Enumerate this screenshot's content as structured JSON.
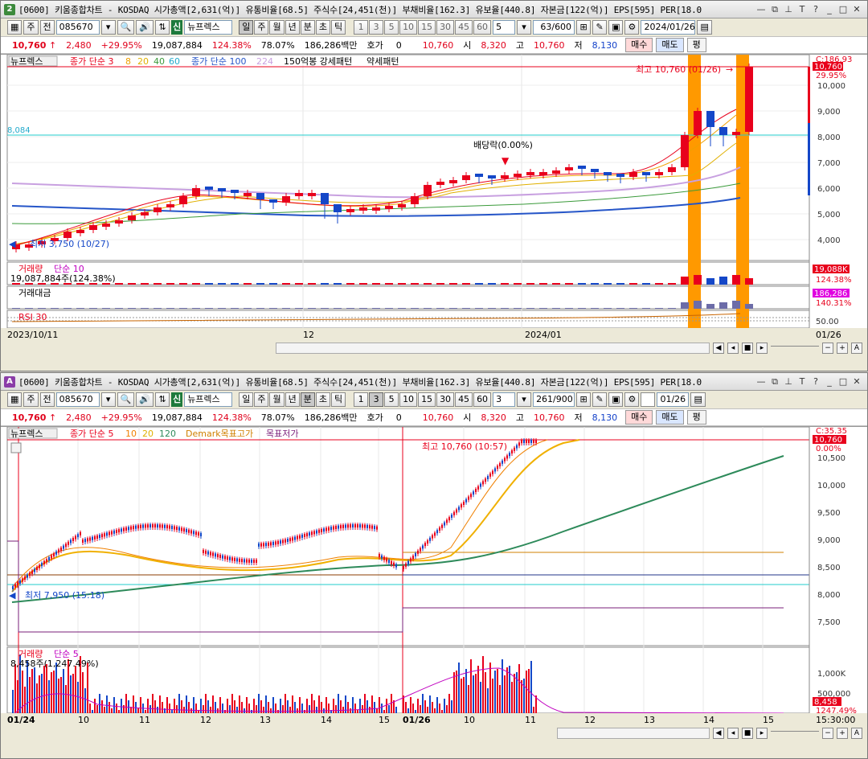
{
  "top": {
    "badge": "2",
    "title": "[0600] 키움종합차트 - KOSDAQ 시가총액[2,631(억)] 유통비율[68.5] 주식수[24,451(천)] 부채비율[162.3] 유보율[440.8] 자본금[122(억)] EPS[595] PER[18.0",
    "code": "085670",
    "stock_name": "뉴프렉스",
    "sin_label": "신",
    "period_tabs": [
      "일",
      "주",
      "월",
      "년",
      "분",
      "초",
      "틱"
    ],
    "active_period": "일",
    "minute_tabs": [
      "1",
      "3",
      "5",
      "10",
      "15",
      "30",
      "45",
      "60"
    ],
    "interval_value": "5",
    "count_value": "63/600",
    "date_value": "2024/01/26",
    "ju": "주",
    "jeon": "전",
    "price": {
      "current": "10,760",
      "arrow": "↑",
      "change": "2,480",
      "pct": "+29.95%",
      "volume": "19,087,884",
      "vol_pct": "124.38%",
      "turnover": "78.07%",
      "amount": "186,286백만",
      "hoga_label": "호가",
      "hoga": "0",
      "open_label": "시",
      "open": "8,320",
      "high_label": "고",
      "high": "10,760",
      "low_label": "저",
      "low": "8,130",
      "buy": "매수",
      "sell": "매도",
      "eval": "평"
    },
    "legend": {
      "name": "뉴프렉스",
      "ma1": "종가 단순 3",
      "ma1_vals": [
        "8",
        "20",
        "40",
        "60"
      ],
      "ma2": "종가 단순 100",
      "ma2_val": "224",
      "pattern": "150억봉 강세패턴",
      "pattern2": "약세패턴"
    },
    "annotations": {
      "high": "최고 10,760 (01/26)",
      "low": "최저 3,750 (10/27)",
      "dividend": "배당락(0.00%)",
      "cyan_level": "8,084"
    },
    "y_ticks": [
      "10,000",
      "9,000",
      "8,000",
      "7,000",
      "6,000",
      "5,000",
      "4,000"
    ],
    "right_labels": {
      "top": "C:186.93",
      "price": "10,760",
      "pct": "29.95%",
      "vol": "19,088K",
      "vol_pct": "124.38%",
      "amt": "186,286",
      "amt_pct": "140.31%",
      "rsi": "50.00"
    },
    "volume_legend": {
      "label": "거래량",
      "ma": "단순 10",
      "value": "19,087,884주(124.38%)"
    },
    "amount_legend": "거래대금",
    "rsi_legend": "RSI 30",
    "x_ticks": [
      "2023/10/11",
      "12",
      "2024/01",
      "01/26"
    ]
  },
  "bottom": {
    "badge": "A",
    "title": "[0600] 키움종합차트 - KOSDAQ 시가총액[2,631(억)] 유통비율[68.5] 주식수[24,451(천)] 부채비율[162.3] 유보율[440.8] 자본금[122(억)] EPS[595] PER[18.0",
    "code": "085670",
    "stock_name": "뉴프렉스",
    "sin_label": "신",
    "period_tabs": [
      "일",
      "주",
      "월",
      "년",
      "분",
      "초",
      "틱"
    ],
    "active_period": "분",
    "minute_tabs": [
      "1",
      "3",
      "5",
      "10",
      "15",
      "30",
      "45",
      "60"
    ],
    "active_minute": "3",
    "interval_value": "3",
    "count_value": "261/900",
    "date_value": "01/26",
    "price": {
      "current": "10,760",
      "arrow": "↑",
      "change": "2,480",
      "pct": "+29.95%",
      "volume": "19,087,884",
      "vol_pct": "124.38%",
      "turnover": "78.07%",
      "amount": "186,286백만",
      "hoga_label": "호가",
      "hoga": "0",
      "open_label": "시",
      "open": "8,320",
      "high_label": "고",
      "high": "10,760",
      "low_label": "저",
      "low": "8,130",
      "buy": "매수",
      "sell": "매도",
      "eval": "평"
    },
    "legend": {
      "name": "뉴프렉스",
      "ma": "종가 단순 5",
      "ma_vals": [
        "10",
        "20",
        "120"
      ],
      "demark": "Demark목표고가",
      "demark2": "목표저가"
    },
    "annotations": {
      "high": "최고 10,760 (10:57)",
      "low": "최저 7,950 (15:18)"
    },
    "y_ticks": [
      "10,500",
      "10,000",
      "9,500",
      "9,000",
      "8,500",
      "8,000",
      "7,500"
    ],
    "right_labels": {
      "top": "C:35.35",
      "price": "10,760",
      "pct": "0.00%",
      "vol": "8,458",
      "vol_pct": "1247.49%"
    },
    "vol_ticks": [
      "1,000K",
      "500,000"
    ],
    "volume_legend": {
      "label": "거래량",
      "ma": "단순 5",
      "value": "8,458주(1,247.49%)"
    },
    "x_ticks": [
      "01/24",
      "10",
      "11",
      "12",
      "13",
      "14",
      "15",
      "01/26",
      "10",
      "11",
      "12",
      "13",
      "14",
      "15",
      "15:30:00"
    ]
  },
  "colors": {
    "up": "#e8001c",
    "down": "#1447c8",
    "orange": "#ff9900",
    "cyan": "#22cccc",
    "purple": "#7a1f7a"
  }
}
